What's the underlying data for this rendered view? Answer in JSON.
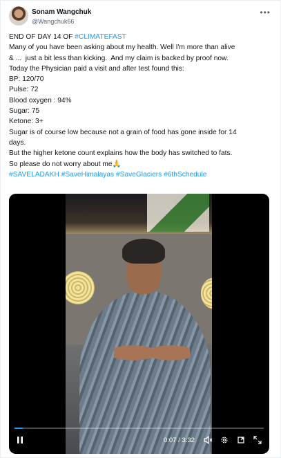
{
  "author": {
    "name": "Sonam Wangchuk",
    "handle": "@Wangchuk66"
  },
  "menu_icon": "more-horizontal-icon",
  "tweet": {
    "line1_prefix": "END OF DAY 14 OF ",
    "line1_tag": "#CLIMATEFAST",
    "line2": "Many of you have been asking about my health. Well I'm more than alive",
    "line3": "& ...  just a bit less than kicking.  And my claim is backed by proof now.",
    "line4": "Today the Physician paid a visit and after test found this:",
    "bp": "BP: 120/70",
    "pulse": "Pulse: 72",
    "oxygen": "Blood oxygen : 94%",
    "sugar": "Sugar: 75",
    "ketone": "Ketone: 3+",
    "line10": "Sugar is of course low because not a grain of food has gone inside for 14",
    "line11": "days.",
    "line12": "But the higher ketone count explains how the body has switched to fats.",
    "line13": "So please do not worry about me",
    "emoji": "🙏",
    "hashtags": [
      "#SAVELADAKH",
      "#SaveHimalayas",
      "#SaveGlaciers",
      "#6thSchedule"
    ]
  },
  "video": {
    "time": "0:07 / 3:32",
    "progress_fraction": 0.033,
    "accent": "#1d9bf0"
  },
  "colors": {
    "link": "#1d9bf0",
    "text": "#0f1419",
    "secondary": "#536471"
  }
}
